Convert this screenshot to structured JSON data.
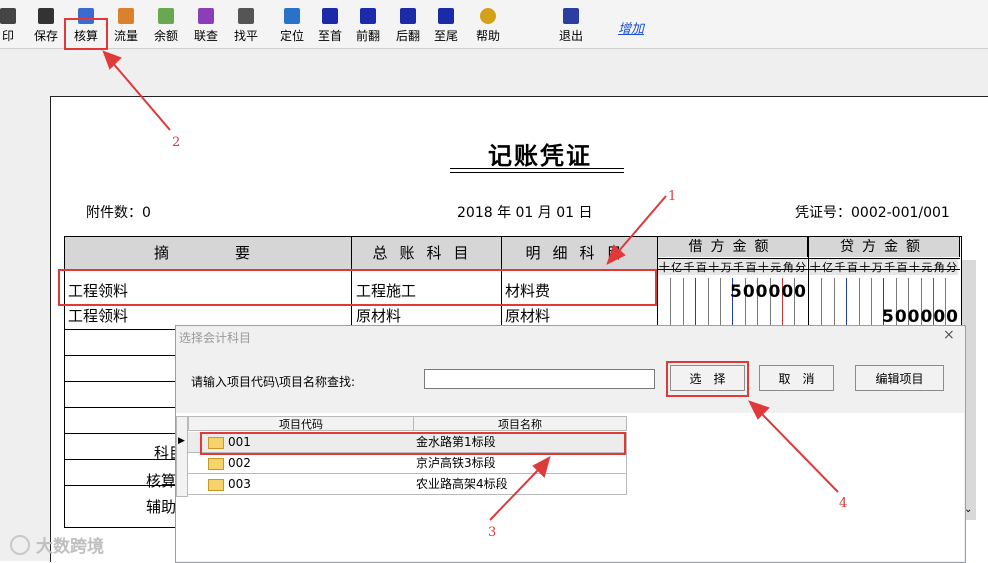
{
  "toolbar": {
    "items": [
      {
        "label": "印",
        "icon": "print-icon"
      },
      {
        "label": "保存",
        "icon": "save-icon"
      },
      {
        "label": "核算",
        "icon": "paperclip-icon"
      },
      {
        "label": "流量",
        "icon": "flow-icon"
      },
      {
        "label": "余额",
        "icon": "balance-icon"
      },
      {
        "label": "联查",
        "icon": "link-query-icon"
      },
      {
        "label": "找平",
        "icon": "scale-icon"
      },
      {
        "label": "定位",
        "icon": "locate-icon"
      },
      {
        "label": "至首",
        "icon": "first-icon"
      },
      {
        "label": "前翻",
        "icon": "prev-icon"
      },
      {
        "label": "后翻",
        "icon": "next-icon"
      },
      {
        "label": "至尾",
        "icon": "last-icon"
      },
      {
        "label": "帮助",
        "icon": "help-icon"
      },
      {
        "label": "退出",
        "icon": "exit-icon"
      }
    ],
    "add_link": "增加"
  },
  "voucher": {
    "title": "记账凭证",
    "attachments": "附件数：0",
    "date": "2018 年 01 月 01 日",
    "number": "凭证号：0002-001/001",
    "headers": {
      "summary": "摘　　要",
      "ledger": "总账科目",
      "detail": "明细科目",
      "debit": "借方金额",
      "credit": "贷方金额"
    },
    "digit_units": [
      "十",
      "亿",
      "千",
      "百",
      "十",
      "万",
      "千",
      "百",
      "十",
      "元",
      "角",
      "分"
    ],
    "rows": [
      {
        "summary": "工程领料",
        "ledger": "工程施工",
        "detail": "材料费",
        "debit": "500000",
        "credit": ""
      },
      {
        "summary": "工程领料",
        "ledger": "原材料",
        "detail": "原材料",
        "debit": "",
        "credit": "500000"
      }
    ],
    "footer_labels": [
      "科目",
      "核算",
      "辅助"
    ]
  },
  "dialog": {
    "title": "选择会计科目",
    "close": "×",
    "search_label": "请输入项目代码\\项目名称查找:",
    "search_value": "",
    "buttons": {
      "select": "选　择",
      "cancel": "取　消",
      "edit": "编辑项目"
    },
    "columns": [
      "项目代码",
      "项目名称"
    ],
    "rows": [
      {
        "code": "001",
        "name": "金水路第1标段"
      },
      {
        "code": "002",
        "name": "京泸高铁3标段"
      },
      {
        "code": "003",
        "name": "农业路高架4标段"
      }
    ]
  },
  "callouts": [
    "1",
    "2",
    "3",
    "4"
  ],
  "watermark": "大数跨境",
  "colors": {
    "annotation": "#e0393a",
    "link": "#1a4fd6",
    "dialog_bg": "#f0f0f0",
    "header_bg": "#d6d6d6"
  }
}
